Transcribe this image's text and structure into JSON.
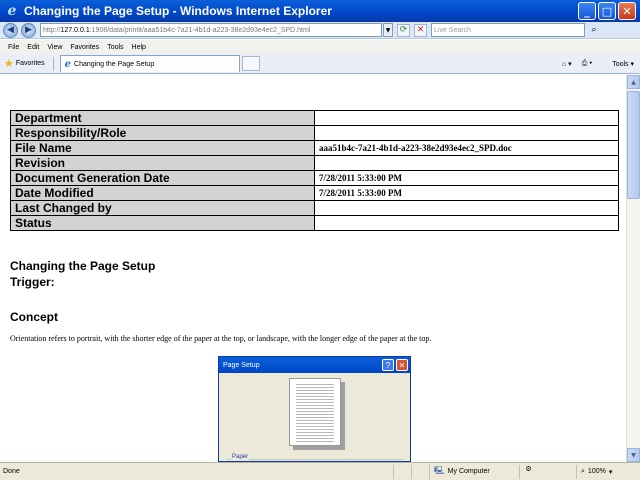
{
  "window": {
    "title": "Changing the Page Setup - Windows Internet Explorer"
  },
  "address": {
    "prefix": "http://",
    "host": "127.0.0.1",
    "rest": ":1908/data/printit/aaa51b4c-7a21-4b1d-a223-38e2d93e4ec2_SPD.html"
  },
  "search": {
    "placeholder": "Live Search"
  },
  "menu": [
    "File",
    "Edit",
    "View",
    "Favorites",
    "Tools",
    "Help"
  ],
  "tabs": {
    "favorites": "Favorites",
    "active_tab": "Changing the Page Setup",
    "tools": "Tools"
  },
  "meta_table": [
    {
      "key": "Department",
      "value": ""
    },
    {
      "key": "Responsibility/Role",
      "value": ""
    },
    {
      "key": "File Name",
      "value": "aaa51b4c-7a21-4b1d-a223-38e2d93e4ec2_SPD.doc"
    },
    {
      "key": "Revision",
      "value": ""
    },
    {
      "key": "Document Generation Date",
      "value": "7/28/2011 5:33:00 PM"
    },
    {
      "key": "Date Modified",
      "value": "7/28/2011 5:33:00 PM"
    },
    {
      "key": "Last Changed by",
      "value": ""
    },
    {
      "key": "Status",
      "value": ""
    }
  ],
  "doc": {
    "title": "Changing the Page Setup",
    "trigger": "Trigger:",
    "concept_heading": "Concept",
    "concept_text": "Orientation refers to portrait, with the shorter edge of the paper at the top, or landscape, with the longer edge of the paper at the top."
  },
  "dialog": {
    "title": "Page Setup",
    "help": "?",
    "close": "✕",
    "paper_label": "Paper"
  },
  "status": {
    "text": "Done",
    "zone": "My Computer",
    "zoom": "100%"
  }
}
